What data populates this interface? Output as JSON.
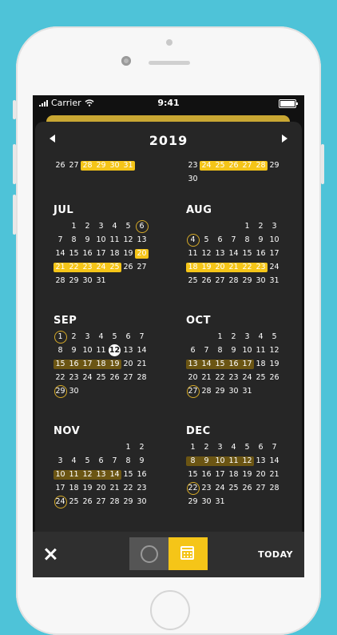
{
  "status": {
    "carrier": "Carrier",
    "time": "9:41"
  },
  "year": "2019",
  "top_rows": [
    {
      "days": [
        "26",
        "27",
        "28",
        "29",
        "30",
        "31"
      ],
      "hl": [
        [
          2,
          5,
          "bright"
        ]
      ]
    },
    {
      "days": [
        "23",
        "24",
        "25",
        "26",
        "27",
        "28",
        "29",
        "30"
      ],
      "hl": [
        [
          1,
          5,
          "bright"
        ]
      ]
    }
  ],
  "months": [
    {
      "name": "JUL",
      "weeks": [
        {
          "start": 1,
          "days": [
            "1",
            "2",
            "3",
            "4",
            "5",
            "6"
          ],
          "hl": [],
          "ring": [
            5
          ]
        },
        {
          "start": 0,
          "days": [
            "7",
            "8",
            "9",
            "10",
            "11",
            "12",
            "13"
          ],
          "hl": []
        },
        {
          "start": 0,
          "days": [
            "14",
            "15",
            "16",
            "17",
            "18",
            "19",
            "20"
          ],
          "hl": [
            [
              6,
              6,
              "bright"
            ]
          ]
        },
        {
          "start": 0,
          "days": [
            "21",
            "22",
            "23",
            "24",
            "25",
            "26",
            "27"
          ],
          "hl": [
            [
              0,
              4,
              "bright"
            ]
          ]
        },
        {
          "start": 0,
          "days": [
            "28",
            "29",
            "30",
            "31"
          ],
          "hl": []
        }
      ]
    },
    {
      "name": "AUG",
      "weeks": [
        {
          "start": 4,
          "days": [
            "1",
            "2",
            "3"
          ],
          "hl": []
        },
        {
          "start": 0,
          "days": [
            "4",
            "5",
            "6",
            "7",
            "8",
            "9",
            "10"
          ],
          "hl": [],
          "ring": [
            0
          ]
        },
        {
          "start": 0,
          "days": [
            "11",
            "12",
            "13",
            "14",
            "15",
            "16",
            "17"
          ],
          "hl": []
        },
        {
          "start": 0,
          "days": [
            "18",
            "19",
            "20",
            "21",
            "22",
            "23",
            "24"
          ],
          "hl": [
            [
              0,
              5,
              "bright"
            ]
          ]
        },
        {
          "start": 0,
          "days": [
            "25",
            "26",
            "27",
            "28",
            "29",
            "30",
            "31"
          ],
          "hl": []
        }
      ]
    },
    {
      "name": "SEP",
      "weeks": [
        {
          "start": 0,
          "days": [
            "1",
            "2",
            "3",
            "4",
            "5",
            "6",
            "7"
          ],
          "hl": [],
          "ring": [
            0
          ]
        },
        {
          "start": 0,
          "days": [
            "8",
            "9",
            "10",
            "11",
            "12",
            "13",
            "14"
          ],
          "hl": [],
          "today": [
            4
          ]
        },
        {
          "start": 0,
          "days": [
            "15",
            "16",
            "17",
            "18",
            "19",
            "20",
            "21"
          ],
          "hl": [
            [
              0,
              4,
              "dim"
            ]
          ]
        },
        {
          "start": 0,
          "days": [
            "22",
            "23",
            "24",
            "25",
            "26",
            "27",
            "28"
          ],
          "hl": []
        },
        {
          "start": 0,
          "days": [
            "29",
            "30"
          ],
          "hl": [],
          "ring": [
            0
          ]
        }
      ]
    },
    {
      "name": "OCT",
      "weeks": [
        {
          "start": 2,
          "days": [
            "1",
            "2",
            "3",
            "4",
            "5"
          ],
          "hl": []
        },
        {
          "start": 0,
          "days": [
            "6",
            "7",
            "8",
            "9",
            "10",
            "11",
            "12"
          ],
          "hl": []
        },
        {
          "start": 0,
          "days": [
            "13",
            "14",
            "15",
            "16",
            "17",
            "18",
            "19"
          ],
          "hl": [
            [
              0,
              4,
              "dim"
            ]
          ]
        },
        {
          "start": 0,
          "days": [
            "20",
            "21",
            "22",
            "23",
            "24",
            "25",
            "26"
          ],
          "hl": []
        },
        {
          "start": 0,
          "days": [
            "27",
            "28",
            "29",
            "30",
            "31"
          ],
          "hl": [],
          "ring": [
            0
          ]
        }
      ]
    },
    {
      "name": "NOV",
      "weeks": [
        {
          "start": 5,
          "days": [
            "1",
            "2"
          ],
          "hl": []
        },
        {
          "start": 0,
          "days": [
            "3",
            "4",
            "5",
            "6",
            "7",
            "8",
            "9"
          ],
          "hl": []
        },
        {
          "start": 0,
          "days": [
            "10",
            "11",
            "12",
            "13",
            "14",
            "15",
            "16"
          ],
          "hl": [
            [
              0,
              4,
              "dim"
            ]
          ]
        },
        {
          "start": 0,
          "days": [
            "17",
            "18",
            "19",
            "20",
            "21",
            "22",
            "23"
          ],
          "hl": []
        },
        {
          "start": 0,
          "days": [
            "24",
            "25",
            "26",
            "27",
            "28",
            "29",
            "30"
          ],
          "hl": [],
          "ring": [
            0
          ]
        }
      ]
    },
    {
      "name": "DEC",
      "weeks": [
        {
          "start": 0,
          "days": [
            "1",
            "2",
            "3",
            "4",
            "5",
            "6",
            "7"
          ],
          "hl": []
        },
        {
          "start": 0,
          "days": [
            "8",
            "9",
            "10",
            "11",
            "12",
            "13",
            "14"
          ],
          "hl": [
            [
              0,
              4,
              "dim"
            ]
          ]
        },
        {
          "start": 0,
          "days": [
            "15",
            "16",
            "17",
            "18",
            "19",
            "20",
            "21"
          ],
          "hl": []
        },
        {
          "start": 0,
          "days": [
            "22",
            "23",
            "24",
            "25",
            "26",
            "27",
            "28"
          ],
          "hl": [],
          "ring": [
            0
          ]
        },
        {
          "start": 0,
          "days": [
            "29",
            "30",
            "31"
          ],
          "hl": []
        }
      ]
    }
  ],
  "bottom": {
    "today_label": "TODAY"
  },
  "icons": {
    "close": "close-icon",
    "circle": "circle-view-icon",
    "calendar": "calendar-view-icon",
    "prev": "chevron-left-icon",
    "next": "chevron-right-icon"
  },
  "colors": {
    "accent": "#f5c518",
    "accent_dim": "#6b5513",
    "ring": "#d4a928",
    "background": "#262626",
    "page": "#4ec3d8"
  }
}
